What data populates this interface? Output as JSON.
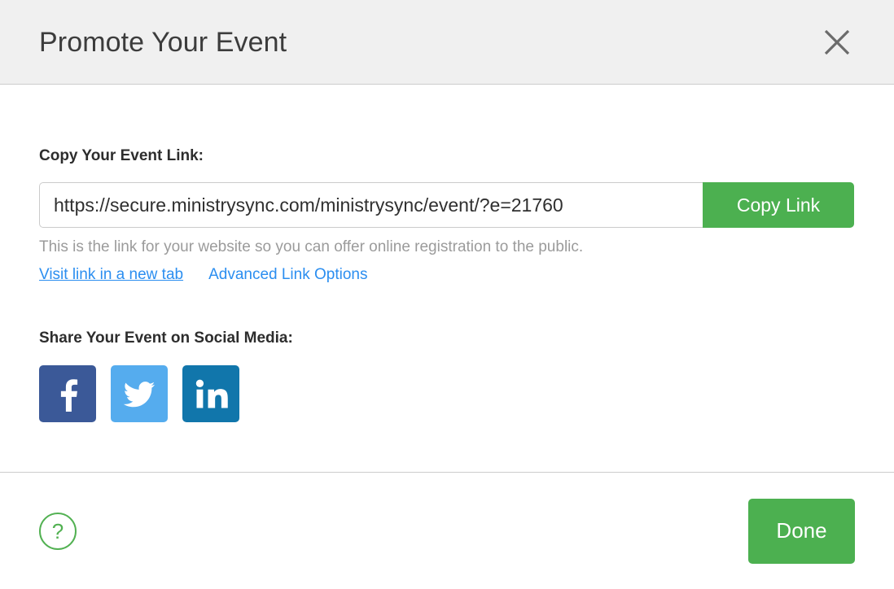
{
  "header": {
    "title": "Promote Your Event",
    "close_icon": "close-icon"
  },
  "body": {
    "link_section": {
      "label": "Copy Your Event Link:",
      "input_value": "https://secure.ministrysync.com/ministrysync/event/?e=21760",
      "input_placeholder": "Event link",
      "copy_button_label": "Copy Link",
      "help_text": "This is the link for your website so you can offer online registration to the public.",
      "links": [
        {
          "label": "Visit link in a new tab",
          "underline": true
        },
        {
          "label": "Advanced Link Options",
          "underline": false
        }
      ]
    },
    "social_section": {
      "label": "Share Your Event on Social Media:",
      "icons": [
        {
          "name": "facebook-icon",
          "label": "Facebook",
          "color": "#3b5998"
        },
        {
          "name": "twitter-icon",
          "label": "Twitter",
          "color": "#55acee"
        },
        {
          "name": "linkedin-icon",
          "label": "LinkedIn",
          "color": "#1176ab"
        }
      ]
    }
  },
  "footer": {
    "help_icon_label": "?",
    "done_button_label": "Done"
  },
  "colors": {
    "green": "#4cb050",
    "blue_link": "#2b8ef0",
    "header_bg": "#f0f0f0",
    "border": "#cccccc",
    "muted_text": "#9b9b9b"
  }
}
